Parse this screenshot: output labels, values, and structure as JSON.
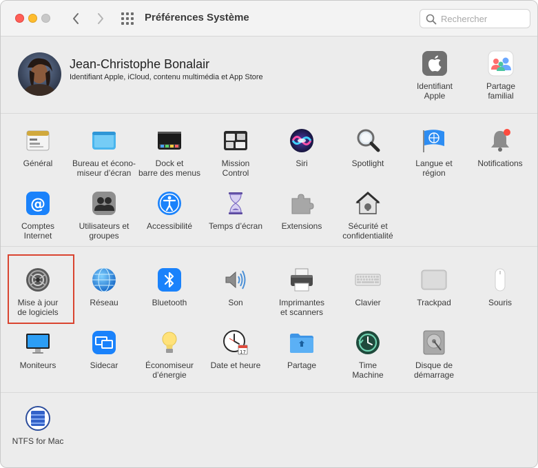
{
  "window": {
    "title": "Préférences Système"
  },
  "search": {
    "placeholder": "Rechercher"
  },
  "account": {
    "name": "Jean-Christophe Bonalair",
    "subtitle": "Identifiant Apple, iCloud, contenu multimédia et App Store",
    "items": [
      {
        "label": "Identifiant\nApple",
        "icon": "apple-id-icon"
      },
      {
        "label": "Partage\nfamilial",
        "icon": "family-sharing-icon"
      }
    ]
  },
  "sections": [
    {
      "items": [
        {
          "label": "Général",
          "icon": "general-icon"
        },
        {
          "label": "Bureau et écono-\nmiseur d’écran",
          "icon": "desktop-screensaver-icon"
        },
        {
          "label": "Dock et\nbarre des menus",
          "icon": "dock-menubar-icon"
        },
        {
          "label": "Mission\nControl",
          "icon": "mission-control-icon"
        },
        {
          "label": "Siri",
          "icon": "siri-icon"
        },
        {
          "label": "Spotlight",
          "icon": "spotlight-icon"
        },
        {
          "label": "Langue et\nrégion",
          "icon": "language-region-icon"
        },
        {
          "label": "Notifications",
          "icon": "notifications-icon"
        },
        {
          "label": "Comptes\nInternet",
          "icon": "internet-accounts-icon"
        },
        {
          "label": "Utilisateurs et\ngroupes",
          "icon": "users-groups-icon"
        },
        {
          "label": "Accessibilité",
          "icon": "accessibility-icon"
        },
        {
          "label": "Temps d’écran",
          "icon": "screen-time-icon"
        },
        {
          "label": "Extensions",
          "icon": "extensions-icon"
        },
        {
          "label": "Sécurité et\nconfidentialité",
          "icon": "security-privacy-icon"
        }
      ]
    },
    {
      "items": [
        {
          "label": "Mise à jour\nde logiciels",
          "icon": "software-update-icon"
        },
        {
          "label": "Réseau",
          "icon": "network-icon"
        },
        {
          "label": "Bluetooth",
          "icon": "bluetooth-icon"
        },
        {
          "label": "Son",
          "icon": "sound-icon"
        },
        {
          "label": "Imprimantes\net scanners",
          "icon": "printers-scanners-icon"
        },
        {
          "label": "Clavier",
          "icon": "keyboard-icon"
        },
        {
          "label": "Trackpad",
          "icon": "trackpad-icon"
        },
        {
          "label": "Souris",
          "icon": "mouse-icon"
        },
        {
          "label": "Moniteurs",
          "icon": "displays-icon"
        },
        {
          "label": "Sidecar",
          "icon": "sidecar-icon"
        },
        {
          "label": "Économiseur\nd’énergie",
          "icon": "energy-saver-icon"
        },
        {
          "label": "Date et heure",
          "icon": "date-time-icon"
        },
        {
          "label": "Partage",
          "icon": "sharing-icon"
        },
        {
          "label": "Time\nMachine",
          "icon": "time-machine-icon"
        },
        {
          "label": "Disque de\ndémarrage",
          "icon": "startup-disk-icon"
        }
      ]
    },
    {
      "items": [
        {
          "label": "NTFS for Mac",
          "icon": "ntfs-for-mac-icon"
        }
      ]
    }
  ],
  "selected_pane": "Mise à jour\nde logiciels",
  "colors": {
    "highlight_border": "#d9432f",
    "accent_blue": "#1a82fb"
  }
}
